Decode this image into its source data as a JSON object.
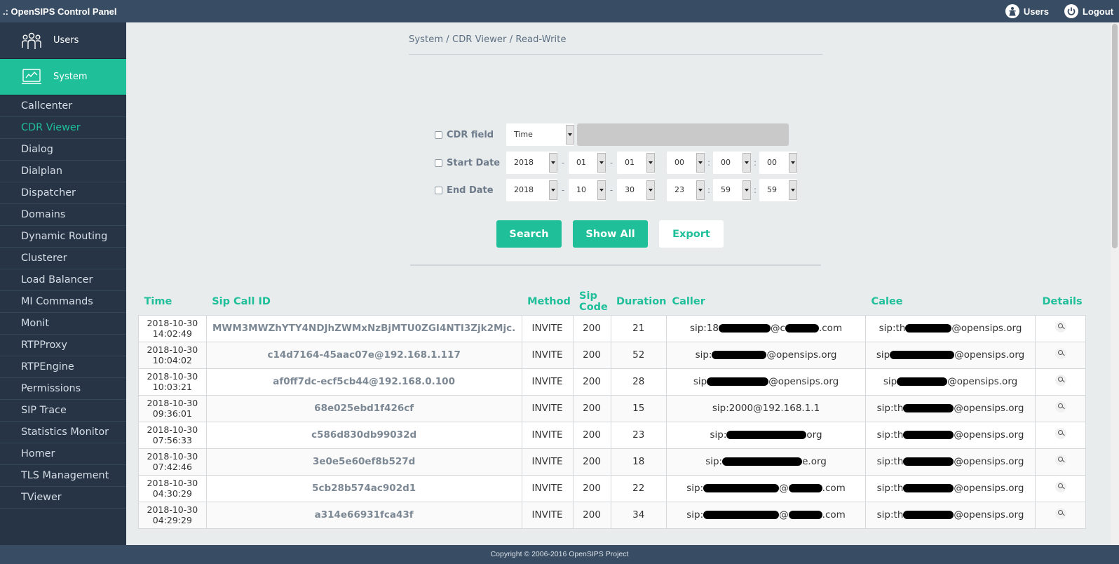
{
  "header": {
    "title": ".: OpenSIPS Control Panel",
    "users_label": "Users",
    "logout_label": "Logout"
  },
  "sidebar": {
    "users_label": "Users",
    "system_label": "System",
    "items": [
      {
        "label": "Callcenter"
      },
      {
        "label": "CDR Viewer",
        "active": true
      },
      {
        "label": "Dialog"
      },
      {
        "label": "Dialplan"
      },
      {
        "label": "Dispatcher"
      },
      {
        "label": "Domains"
      },
      {
        "label": "Dynamic Routing"
      },
      {
        "label": "Clusterer"
      },
      {
        "label": "Load Balancer"
      },
      {
        "label": "MI Commands"
      },
      {
        "label": "Monit"
      },
      {
        "label": "RTPProxy"
      },
      {
        "label": "RTPEngine"
      },
      {
        "label": "Permissions"
      },
      {
        "label": "SIP Trace"
      },
      {
        "label": "Statistics Monitor"
      },
      {
        "label": "Homer"
      },
      {
        "label": "TLS Management"
      },
      {
        "label": "TViewer"
      }
    ]
  },
  "breadcrumb": "System / CDR Viewer / Read-Write",
  "filters": {
    "cdr_field_label": "CDR field",
    "cdr_field_value": "Time",
    "start_label": "Start Date",
    "end_label": "End Date",
    "start": {
      "year": "2018",
      "month": "01",
      "day": "01",
      "hour": "00",
      "minute": "00",
      "second": "00"
    },
    "end": {
      "year": "2018",
      "month": "10",
      "day": "30",
      "hour": "23",
      "minute": "59",
      "second": "59"
    }
  },
  "buttons": {
    "search": "Search",
    "show_all": "Show All",
    "export": "Export"
  },
  "table": {
    "headers": {
      "time": "Time",
      "call_id": "Sip Call ID",
      "method": "Method",
      "sip_code": "Sip Code",
      "duration": "Duration",
      "caller": "Caller",
      "callee": "Calee",
      "details": "Details"
    },
    "rows": [
      {
        "date": "2018-10-30",
        "clock": "14:02:49",
        "call_id": "MWM3MWZhYTY4NDJhZWMxNzBjMTU0ZGI4NTI3Zjk2Mjc.",
        "method": "INVITE",
        "code": "200",
        "duration": "21",
        "caller_pre": "sip:18",
        "caller_post": "@c",
        "caller_tail": ".com",
        "callee_pre": "sip:th",
        "callee_post": "@opensips.org",
        "callee_tail": ""
      },
      {
        "date": "2018-10-30",
        "clock": "10:04:02",
        "call_id": "c14d7164-45aac07e@192.168.1.117",
        "method": "INVITE",
        "code": "200",
        "duration": "52",
        "caller_pre": "sip:",
        "caller_post": "@opensips.org",
        "caller_tail": "",
        "callee_pre": "sip",
        "callee_post": "@opensips.org",
        "callee_tail": ""
      },
      {
        "date": "2018-10-30",
        "clock": "10:03:21",
        "call_id": "af0ff7dc-ecf5cb44@192.168.0.100",
        "method": "INVITE",
        "code": "200",
        "duration": "28",
        "caller_pre": "sip",
        "caller_post": "@opensips.org",
        "caller_tail": "",
        "callee_pre": "sip",
        "callee_post": "@opensips.org",
        "callee_tail": ""
      },
      {
        "date": "2018-10-30",
        "clock": "09:36:01",
        "call_id": "68e025ebd1f426cf",
        "method": "INVITE",
        "code": "200",
        "duration": "15",
        "caller_pre": "sip:2000@192.168.1.1",
        "caller_post": "",
        "caller_tail": "",
        "callee_pre": "sip:th",
        "callee_post": "@opensips.org",
        "callee_tail": ""
      },
      {
        "date": "2018-10-30",
        "clock": "07:56:33",
        "call_id": "c586d830db99032d",
        "method": "INVITE",
        "code": "200",
        "duration": "23",
        "caller_pre": "sip:",
        "caller_post": "org",
        "caller_tail": "",
        "callee_pre": "sip:th",
        "callee_post": "@opensips.org",
        "callee_tail": ""
      },
      {
        "date": "2018-10-30",
        "clock": "07:42:46",
        "call_id": "3e0e5e60ef8b527d",
        "method": "INVITE",
        "code": "200",
        "duration": "18",
        "caller_pre": "sip:",
        "caller_post": "e.org",
        "caller_tail": "",
        "callee_pre": "sip:th",
        "callee_post": "@opensips.org",
        "callee_tail": ""
      },
      {
        "date": "2018-10-30",
        "clock": "04:30:29",
        "call_id": "5cb28b574ac902d1",
        "method": "INVITE",
        "code": "200",
        "duration": "22",
        "caller_pre": "sip:",
        "caller_post": "@",
        "caller_tail": ".com",
        "callee_pre": "sip:th",
        "callee_post": "@opensips.org",
        "callee_tail": ""
      },
      {
        "date": "2018-10-30",
        "clock": "04:29:29",
        "call_id": "a314e66931fca43f",
        "method": "INVITE",
        "code": "200",
        "duration": "34",
        "caller_pre": "sip:",
        "caller_post": "@",
        "caller_tail": ".com",
        "callee_pre": "sip:th",
        "callee_post": "@opensips.org",
        "callee_tail": ""
      }
    ]
  },
  "footer": "Copyright © 2006-2016 OpenSIPS Project",
  "colors": {
    "accent": "#1ebf99",
    "topbar": "#384c64",
    "sidebar": "#263445",
    "redaction": "#000000"
  },
  "icons": {
    "users": "user-icon",
    "logout": "power-icon",
    "details": "magnifier-icon"
  }
}
